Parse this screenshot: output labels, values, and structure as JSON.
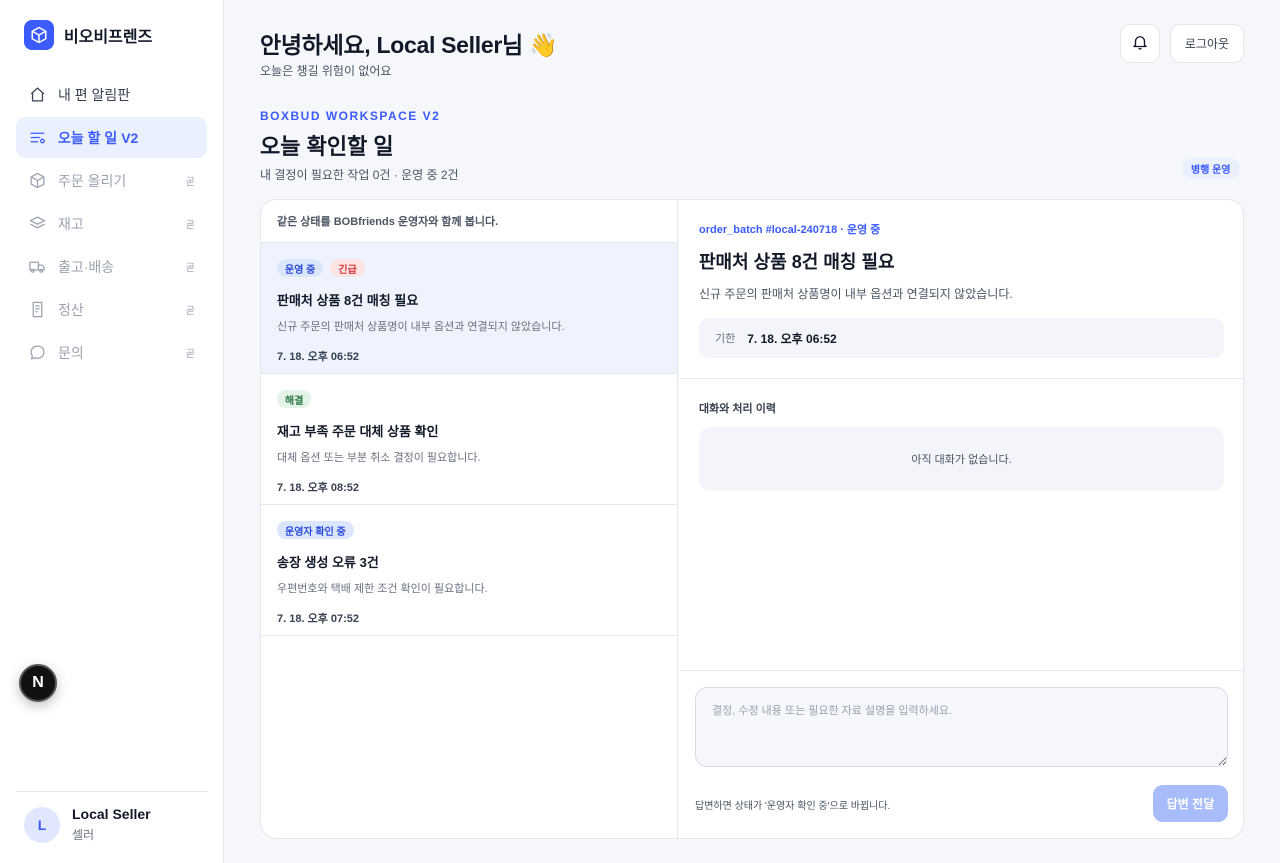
{
  "brand": {
    "name": "비오비프렌즈"
  },
  "sidebar": {
    "items": [
      {
        "label": "내 편 알림판",
        "icon": "home-icon",
        "state": "normal",
        "soon": ""
      },
      {
        "label": "오늘 할 일 V2",
        "icon": "list-icon",
        "state": "active",
        "soon": ""
      },
      {
        "label": "주문 올리기",
        "icon": "box-icon",
        "state": "disabled",
        "soon": "곧"
      },
      {
        "label": "재고",
        "icon": "layers-icon",
        "state": "disabled",
        "soon": "곧"
      },
      {
        "label": "출고·배송",
        "icon": "truck-icon",
        "state": "disabled",
        "soon": "곧"
      },
      {
        "label": "정산",
        "icon": "receipt-icon",
        "state": "disabled",
        "soon": "곧"
      },
      {
        "label": "문의",
        "icon": "chat-icon",
        "state": "disabled",
        "soon": "곧"
      }
    ],
    "next_badge": "N"
  },
  "profile": {
    "initial": "L",
    "name": "Local Seller",
    "role": "셀러"
  },
  "header": {
    "greeting": "안녕하세요, Local Seller님 👋",
    "subtitle": "오늘은 챙길 위험이 없어요",
    "logout_label": "로그아웃"
  },
  "workspace": {
    "eyebrow": "BOXBUD WORKSPACE V2",
    "title": "오늘 확인할 일",
    "subtitle": "내 결정이 필요한 작업 0건 · 운영 중 2건",
    "mode_badge": "병행 운영"
  },
  "task_list": {
    "header": "같은 상태를 BOBfriends 운영자와 함께 봅니다.",
    "tasks": [
      {
        "badges": [
          {
            "text": "운영 중",
            "tone": "blue"
          },
          {
            "text": "긴급",
            "tone": "red"
          }
        ],
        "title": "판매처 상품 8건 매칭 필요",
        "desc": "신규 주문의 판매처 상품명이 내부 옵션과 연결되지 않았습니다.",
        "time": "7. 18. 오후 06:52",
        "selected": true
      },
      {
        "badges": [
          {
            "text": "해결",
            "tone": "green"
          }
        ],
        "title": "재고 부족 주문 대체 상품 확인",
        "desc": "대체 옵션 또는 부분 취소 결정이 필요합니다.",
        "time": "7. 18. 오후 08:52",
        "selected": false
      },
      {
        "badges": [
          {
            "text": "운영자 확인 중",
            "tone": "blue"
          }
        ],
        "title": "송장 생성 오류 3건",
        "desc": "우편번호와 택배 제한 조건 확인이 필요합니다.",
        "time": "7. 18. 오후 07:52",
        "selected": false
      }
    ]
  },
  "detail": {
    "ref": "order_batch #local-240718 · 운영 중",
    "title": "판매처 상품 8건 매칭 필요",
    "desc": "신규 주문의 판매처 상품명이 내부 옵션과 연결되지 않았습니다.",
    "deadline_label": "기한",
    "deadline_value": "7. 18. 오후 06:52",
    "history_title": "대화와 처리 이력",
    "history_empty": "아직 대화가 없습니다.",
    "reply_placeholder": "결정, 수정 내용 또는 필요한 자료 설명을 입력하세요.",
    "reply_value": "",
    "reply_hint": "답변하면 상태가 '운영자 확인 중'으로 바뀝니다.",
    "send_label": "답변 전달"
  },
  "colors": {
    "accent": "#3b5bfd",
    "accent_light": "#eaf0fe",
    "send_disabled": "#a7bcf9"
  }
}
